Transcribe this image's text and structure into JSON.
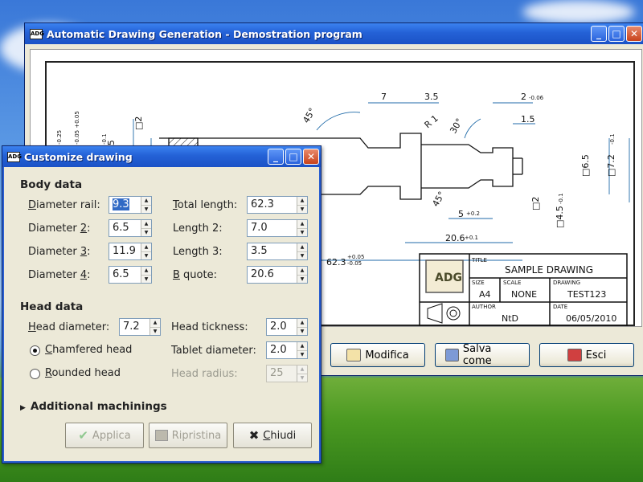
{
  "main_window": {
    "title": "Automatic Drawing Generation - Demostration program",
    "app_icon": "ADG",
    "controls": [
      "_",
      "□",
      "✕"
    ],
    "buttons": {
      "modify": "Modifica",
      "save_as": "Salva come",
      "exit": "Esci"
    }
  },
  "drawing": {
    "dims": {
      "d_7": "7",
      "d_35": "3.5",
      "d_2": "2",
      "d_2_tol": "-0.06",
      "d_15": "1.5",
      "a_45": "45°",
      "r1": "R 1",
      "a_30": "30°",
      "a_45b": "45°",
      "d_5": "5",
      "d_5_tol": "+0.2",
      "d_206": "20.6",
      "d_206_tol": "+0.1",
      "d_623": "62.3",
      "d_623_tol_up": "+0.05",
      "d_623_tol_dn": "-0.05",
      "sq2_top": "□2",
      "sq2_bot": "□2",
      "sq65": "□6.5",
      "sq72": "□7.2",
      "sq72_tol": "-0.1",
      "sq45": "□4.5",
      "sq45_tol": "-0.1",
      "left1": ".9",
      "left1_tol": "-0.25",
      "left2": "□7",
      "left2_tol": "-0.05 +0.05",
      "left3": "□6.5",
      "left3_tol": "-0.1"
    },
    "titleblock": {
      "title_label": "TITLE",
      "title_value": "SAMPLE DRAWING",
      "size_label": "SIZE",
      "size_value": "A4",
      "scale_label": "SCALE",
      "scale_value": "NONE",
      "drawing_label": "DRAWING",
      "drawing_value": "TEST123",
      "author_label": "AUTHOR",
      "author_value": "NtD",
      "date_label": "DATE",
      "date_value": "06/05/2010",
      "logo": "ADG"
    }
  },
  "dialog": {
    "title": "Customize drawing",
    "app_icon": "ADG",
    "body_data": {
      "heading": "Body data",
      "fields": {
        "diameter_rail": {
          "label_u": "D",
          "label": "iameter rail:",
          "value": "9.3"
        },
        "diameter_2": {
          "label": "Diameter ",
          "label_u": "2",
          "label_end": ":",
          "value": "6.5"
        },
        "diameter_3": {
          "label": "Diameter ",
          "label_u": "3",
          "label_end": ":",
          "value": "11.9"
        },
        "diameter_4": {
          "label": "Diameter ",
          "label_u": "4",
          "label_end": ":",
          "value": "6.5"
        },
        "total_length": {
          "label_u": "T",
          "label": "otal length:",
          "value": "62.3"
        },
        "length_2": {
          "label": "Length 2:",
          "value": "7.0"
        },
        "length_3": {
          "label": "Length 3:",
          "value": "3.5"
        },
        "b_quote": {
          "label_u": "B",
          "label": " quote:",
          "value": "20.6"
        }
      }
    },
    "head_data": {
      "heading": "Head data",
      "head_diameter": {
        "label_u": "H",
        "label": "ead diameter:",
        "value": "7.2"
      },
      "head_tickness": {
        "label": "Head tickness:",
        "value": "2.0"
      },
      "tablet_diameter": {
        "label": "Tablet diameter:",
        "value": "2.0"
      },
      "head_radius": {
        "label": "Head radius:",
        "value": "25"
      },
      "chamfered": {
        "label_u": "C",
        "label": "hamfered head",
        "checked": true
      },
      "rounded": {
        "label_u": "R",
        "label": "ounded head",
        "checked": false
      }
    },
    "additional": "Additional machinings",
    "buttons": {
      "apply": "Applica",
      "reset": "Ripristina",
      "close_u": "C",
      "close": "hiudi"
    }
  }
}
